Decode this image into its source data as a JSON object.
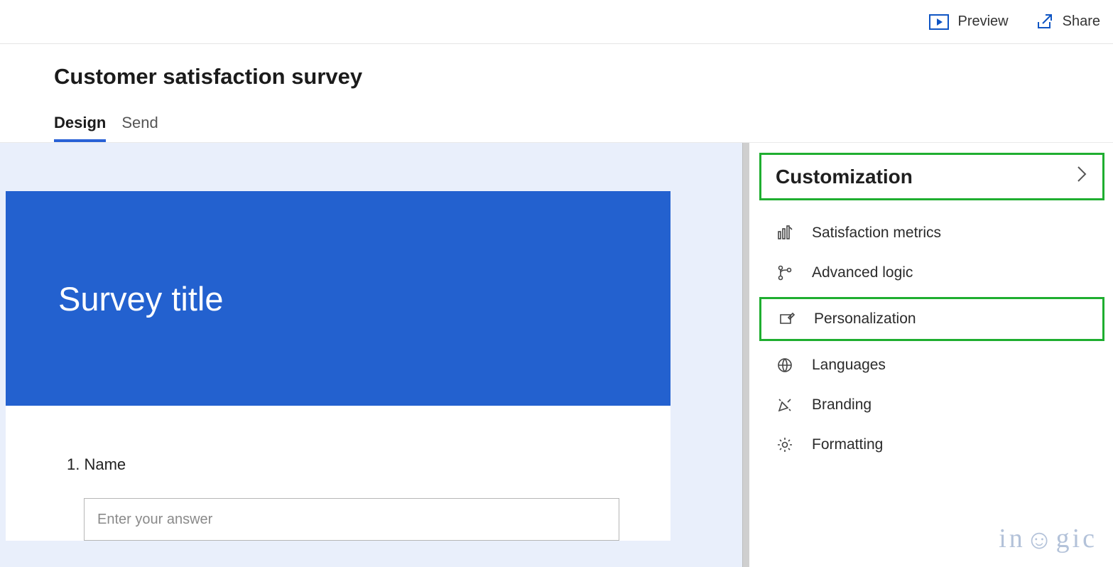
{
  "topbar": {
    "preview": "Preview",
    "share": "Share"
  },
  "page_title": "Customer satisfaction survey",
  "tabs": {
    "design": "Design",
    "send": "Send",
    "active": "design"
  },
  "survey": {
    "hero_title": "Survey title",
    "question1": {
      "number": "1.",
      "label": "Name",
      "placeholder": "Enter your answer"
    }
  },
  "side_panel": {
    "header": "Customization",
    "items": [
      {
        "id": "satisfaction-metrics",
        "label": "Satisfaction metrics"
      },
      {
        "id": "advanced-logic",
        "label": "Advanced logic"
      },
      {
        "id": "personalization",
        "label": "Personalization"
      },
      {
        "id": "languages",
        "label": "Languages"
      },
      {
        "id": "branding",
        "label": "Branding"
      },
      {
        "id": "formatting",
        "label": "Formatting"
      }
    ]
  },
  "watermark": "inogic"
}
